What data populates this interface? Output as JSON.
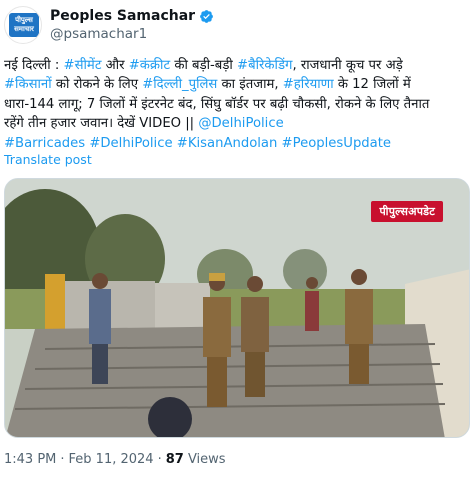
{
  "author": {
    "display_name": "Peoples Samachar",
    "handle": "@psamachar1",
    "avatar_text": "पीपुल्स समाचार",
    "verified": true
  },
  "post": {
    "line1_prefix": "नई दिल्ली : ",
    "line1_tag1": "#सीमेंट",
    "line1_mid": " और ",
    "line1_tag2": "#कंक्रीट",
    "line1_mid2": " की बड़ी-बड़ी ",
    "line1_tag3": "#बैरिकेडिंग",
    "line1_suffix": ", राजधानी कूच पर अड़े",
    "line2_tag1": "#किसानों",
    "line2_mid": " को रोकने के लिए ",
    "line2_tag2": "#दिल्ली_पुलिस",
    "line2_mid2": " का इंतजाम, ",
    "line2_tag3": "#हरियाणा",
    "line2_suffix": " के 12 जिलों में",
    "line3": "धारा-144 लागू; 7 जिलों में इंटरनेट बंद, सिंघु बॉर्डर पर बढ़ी चौकसी, रोकने के लिए तैनात",
    "line4_prefix": "रहेंगे तीन हजार जवान। देखें VIDEO || ",
    "line4_mention": "@DelhiPolice",
    "tags_line": "#Barricades #DelhiPolice #KisanAndolan #PeoplesUpdate",
    "translate_label": "Translate post"
  },
  "media": {
    "watermark_text": "पीपुल्सअपडेट"
  },
  "meta": {
    "time": "1:43 PM",
    "date": "Feb 11, 2024",
    "views_count": "87",
    "views_label": "Views",
    "separator": "·"
  },
  "colors": {
    "link": "#1d9bf0",
    "text": "#0f1419",
    "secondary": "#536471",
    "verified": "#1d9bf0"
  }
}
